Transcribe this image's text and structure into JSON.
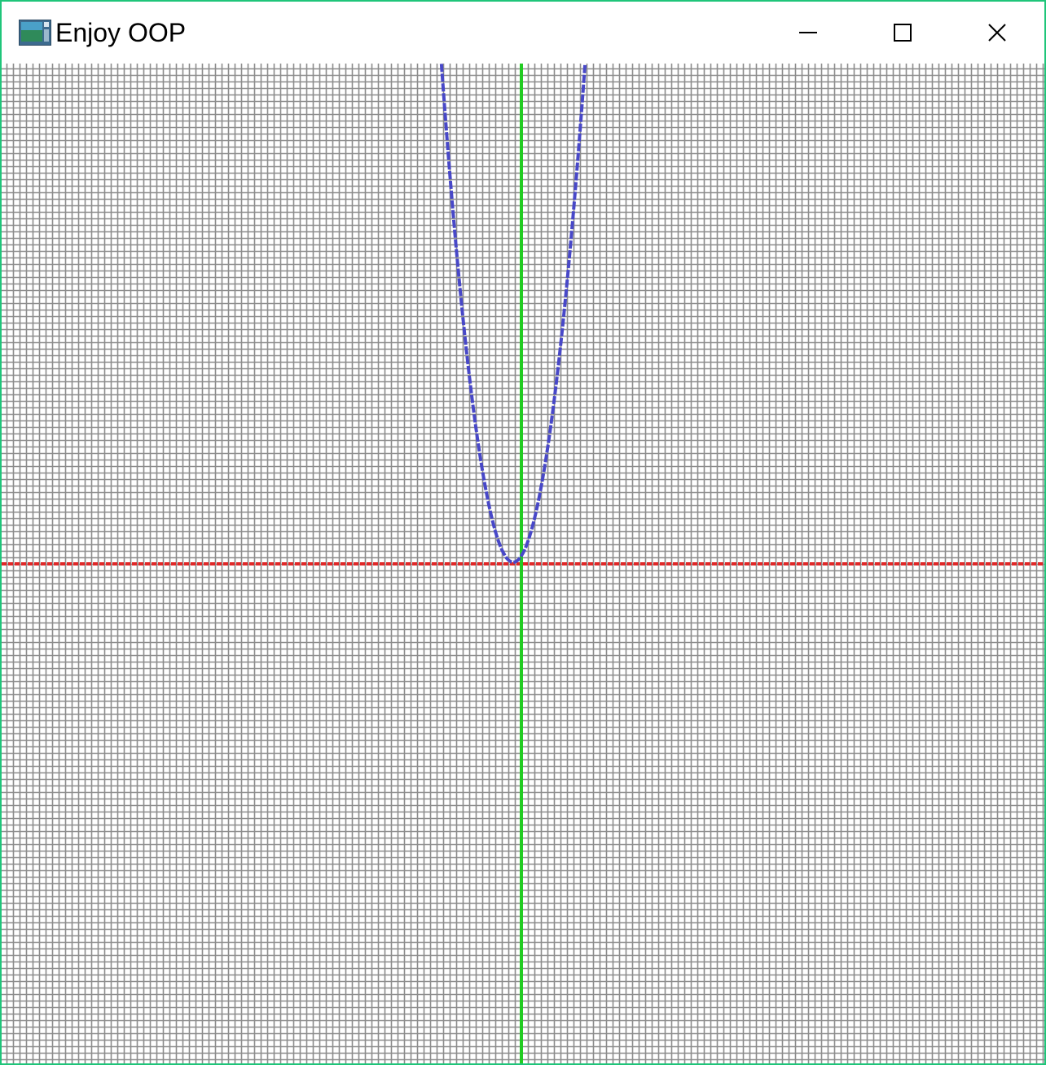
{
  "window": {
    "title": "Enjoy OOP",
    "border_color": "#1fc57a",
    "icon": "app-window-icon",
    "controls": {
      "minimize_icon": "minimize-icon",
      "maximize_icon": "maximize-icon",
      "close_icon": "close-icon"
    }
  },
  "plot": {
    "grid_color": "#8c8c8c",
    "x_axis_color": "#e02828",
    "y_axis_color": "#22cc22",
    "curve_color": "#4848c8"
  }
}
